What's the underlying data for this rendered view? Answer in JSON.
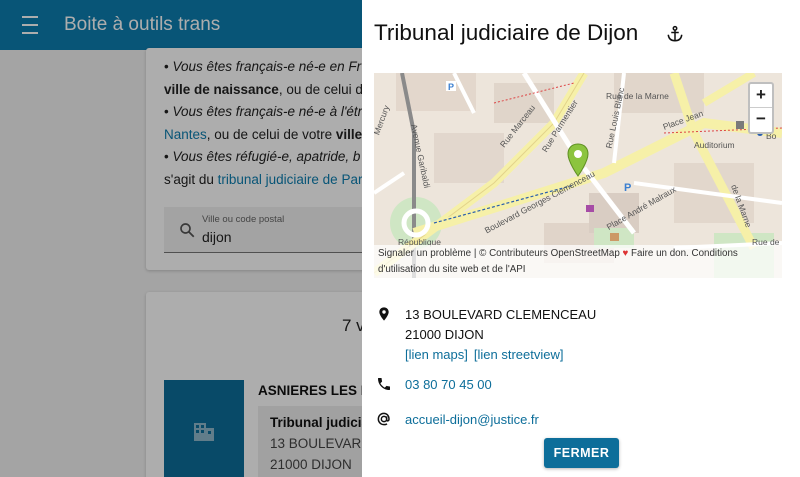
{
  "appbar": {
    "title": "Boite à outils trans"
  },
  "background": {
    "lines": [
      {
        "prefix": "• ",
        "text": "Vous êtes français-e né-e en Fr"
      },
      {
        "bold": "ville de naissance",
        "rest": ", ou de celui de"
      },
      {
        "prefix": "• ",
        "text": "Vous êtes français-e né-e à l'étr"
      },
      {
        "link": "Nantes",
        "rest": ", ou de celui de votre ",
        "bold": "ville"
      },
      {
        "prefix": "• ",
        "text": "Vous êtes réfugié-e, apatride, b"
      },
      {
        "rest": "s'agit du ",
        "link": "tribunal judiciaire de Par"
      }
    ],
    "search": {
      "label": "Ville ou code postal",
      "value": "dijon"
    },
    "result_count": "7 v",
    "result": {
      "name": "ASNIERES LES DI",
      "box_title": "Tribunal judicia",
      "line1": "13 BOULEVARD",
      "line2": "21000 DIJON"
    }
  },
  "drawer": {
    "title": "Tribunal judiciaire de Dijon",
    "map": {
      "zoom_in": "+",
      "zoom_out": "−",
      "attribution": {
        "report": "Signaler un problème",
        "sep": " | © Contributeurs OpenStreetMap ",
        "heart": "♥",
        "donate": " Faire un don. Conditions",
        "terms": "d'utilisation du site web et de l'API"
      },
      "labels": {
        "marceau": "Rue Marceau",
        "parmentier": "Rue Parmentier",
        "clemenceau": "Boulevard Georges Clemenceau",
        "malraux": "Place André Malraux",
        "auditorium": "Auditorium",
        "republique": "République",
        "jean": "Place Jean",
        "marne": "de la Marne",
        "ruemarne": "Rue de la Marne",
        "louisblanc": "Rue Louis Blanc",
        "boulevard": "Bo",
        "mercury": "Mercury",
        "garibaldi": "Avenue Garibaldi",
        "rue_de_la": "Rue de la"
      }
    },
    "address": {
      "line1": "13 BOULEVARD CLEMENCEAU",
      "line2": "21000 DIJON",
      "maps_link": "[lien maps]",
      "streetview_link": "[lien streetview]"
    },
    "phone": "03 80 70 45 00",
    "email": "accueil-dijon@justice.fr",
    "close_label": "FERMER"
  }
}
